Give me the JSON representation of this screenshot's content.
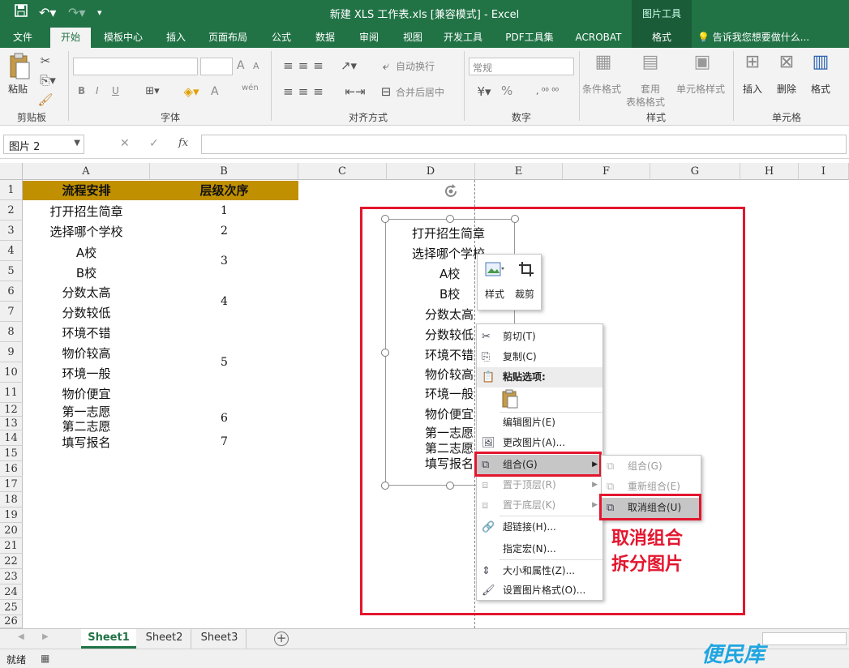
{
  "titlebar": {
    "title": "新建 XLS 工作表.xls  [兼容模式] - Excel",
    "context_tool": "图片工具",
    "qat_save_icon": "save-icon",
    "qat_undo_icon": "undo-icon",
    "qat_redo_icon": "redo-icon"
  },
  "tabs": [
    "文件",
    "开始",
    "模板中心",
    "插入",
    "页面布局",
    "公式",
    "数据",
    "审阅",
    "视图",
    "开发工具",
    "PDF工具集",
    "ACROBAT",
    "格式"
  ],
  "tellme": "告诉我您想要做什么...",
  "ribbon": {
    "clipboard": {
      "label": "剪贴板",
      "paste": "粘贴"
    },
    "font": {
      "label": "字体",
      "bold": "B",
      "italic": "I",
      "underline": "U",
      "grow": "A",
      "shrink": "A",
      "wen": "wén",
      "font_color_a": "A"
    },
    "alignment": {
      "label": "对齐方式",
      "wrap": "自动换行",
      "merge": "合并后居中"
    },
    "number": {
      "label": "数字",
      "format": "常规",
      "percent": "%"
    },
    "styles": {
      "label": "样式",
      "conditional": "条件格式",
      "table_l1": "套用",
      "table_l2": "表格格式",
      "cell_styles": "单元格样式"
    },
    "cells": {
      "label": "单元格",
      "insert": "插入",
      "delete": "删除",
      "format": "格式"
    }
  },
  "formulabar": {
    "namebox": "图片 2",
    "fx": "fx",
    "cancel": "✕",
    "confirm": "✓"
  },
  "columns": [
    "A",
    "B",
    "C",
    "D",
    "E",
    "F",
    "G",
    "H",
    "I"
  ],
  "rows": [
    "1",
    "2",
    "3",
    "4",
    "5",
    "6",
    "7",
    "8",
    "9",
    "10",
    "11",
    "12",
    "13",
    "14",
    "15",
    "16",
    "17",
    "18",
    "19",
    "20",
    "21",
    "22",
    "23",
    "24",
    "25",
    "26"
  ],
  "sheet": {
    "headers": [
      "流程安排",
      "层级次序"
    ],
    "a_values": [
      "打开招生简章",
      "选择哪个学校",
      "A校",
      "B校",
      "分数太高",
      "分数较低",
      "环境不错",
      "物价较高",
      "环境一般",
      "物价便宜",
      "第一志愿",
      "第二志愿",
      "填写报名"
    ],
    "b_values": [
      "1",
      "2",
      "3",
      "4",
      "5",
      "6",
      "7"
    ]
  },
  "picture_lines": [
    "打开招生简章",
    "选择哪个学校",
    "A校",
    "B校",
    "分数太高",
    "分数较低",
    "环境不错",
    "物价较高",
    "环境一般",
    "物价便宜",
    "第一志愿",
    "第二志愿",
    "填写报名"
  ],
  "mini_toolbar": {
    "style": "样式",
    "crop": "裁剪"
  },
  "context_menu": {
    "cut": "剪切(T)",
    "copy": "复制(C)",
    "paste_options": "粘贴选项:",
    "edit_picture": "编辑图片(E)",
    "change_picture": "更改图片(A)...",
    "group": "组合(G)",
    "bring_front": "置于顶层(R)",
    "send_back": "置于底层(K)",
    "hyperlink": "超链接(H)...",
    "assign_macro": "指定宏(N)...",
    "size_props": "大小和属性(Z)...",
    "format_picture": "设置图片格式(O)..."
  },
  "submenu": {
    "group": "组合(G)",
    "regroup": "重新组合(E)",
    "ungroup": "取消组合(U)"
  },
  "annotation": {
    "line1": "取消组合",
    "line2": "拆分图片"
  },
  "sheet_tabs": [
    "Sheet1",
    "Sheet2",
    "Sheet3"
  ],
  "status": "就绪",
  "watermark": "便民库",
  "colors": {
    "excel_green": "#217346",
    "header_fill": "#c09000",
    "highlight_red": "#e3162e",
    "menu_hover": "#c6c6c6"
  }
}
